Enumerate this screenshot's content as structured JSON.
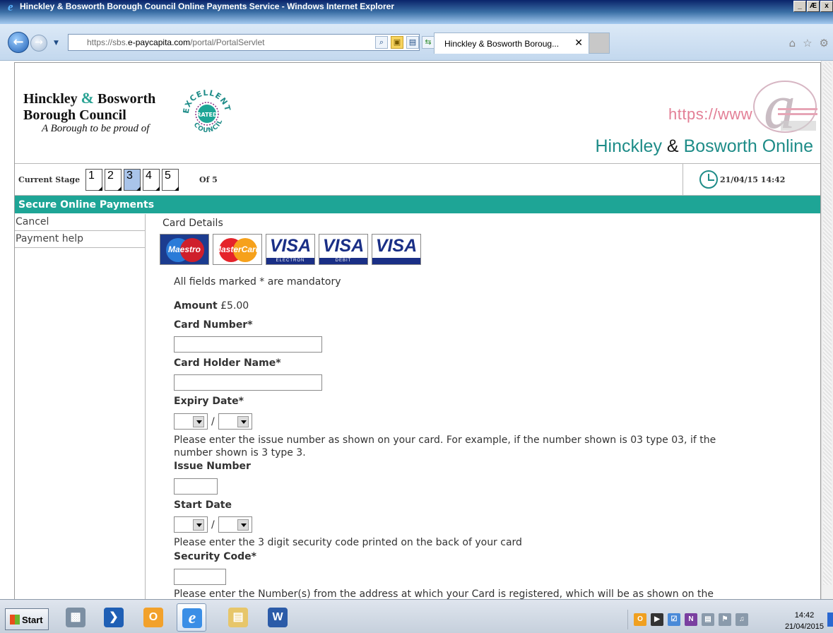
{
  "window": {
    "title": "Hinckley & Bosworth Borough Council Online Payments Service - Windows Internet Explorer",
    "controls": [
      "_",
      "Æ",
      "x"
    ]
  },
  "browser": {
    "url_prefix": "https://sbs.",
    "url_domain": "e-paycapita.com",
    "url_path": "/portal/PortalServlet",
    "tab_title": "Hinckley & Bosworth Boroug...",
    "tab_close": "✕"
  },
  "header": {
    "council_line1_a": "Hinckley",
    "council_line1_amp": "&",
    "council_line1_b": "Bosworth",
    "council_line2": "Borough Council",
    "tagline": "A Borough to be proud of",
    "badge_top": "EXCELLENT",
    "badge_middle": "RATED",
    "badge_bottom": "COUNCIL",
    "https_text": "https://www",
    "online_title_a": "Hinckley",
    "online_title_amp": "&",
    "online_title_b": "Bosworth Online"
  },
  "stages": {
    "label": "Current Stage",
    "items": [
      "1",
      "2",
      "3",
      "4",
      "5"
    ],
    "current": "3",
    "of_label": "Of 5",
    "datetime": "21/04/15 14:42"
  },
  "band": {
    "title": "Secure Online Payments"
  },
  "menu": {
    "items": [
      "Cancel",
      "Payment help"
    ]
  },
  "form": {
    "section_title": "Card Details",
    "cards": [
      "Maestro",
      "MasterCard",
      "VISA",
      "VISA",
      "VISA"
    ],
    "card_subs": [
      "ELECTRON",
      "DEBIT",
      ""
    ],
    "mandatory_note": "All fields marked * are mandatory",
    "amount_label": "Amount",
    "amount_value": "£5.00",
    "card_number_label": "Card Number*",
    "card_number_value": "",
    "card_holder_label": "Card Holder Name*",
    "card_holder_value": "",
    "expiry_label": "Expiry Date*",
    "date_separator": "/",
    "issue_help_line1": "Please enter the issue number as shown on your card. For example, if the number shown is 03 type 03, if the",
    "issue_help_line2": "number shown is 3 type 3.",
    "issue_label": "Issue Number",
    "issue_value": "",
    "start_label": "Start Date",
    "security_help": "Please enter the 3 digit security code printed on the back of your card",
    "security_label": "Security Code*",
    "security_value": "",
    "address_help": "Please enter the Number(s) from the address at which your Card is registered, which will be as shown on the"
  },
  "taskbar": {
    "start_label": "Start",
    "apps": [
      "server-manager",
      "powershell",
      "outlook",
      "internet-explorer",
      "file-explorer",
      "word"
    ],
    "time": "14:42",
    "date": "21/04/2015"
  },
  "colors": {
    "brand_teal": "#1ea596",
    "title_teal": "#1e8c88",
    "active_stage": "#a9c4ea"
  }
}
